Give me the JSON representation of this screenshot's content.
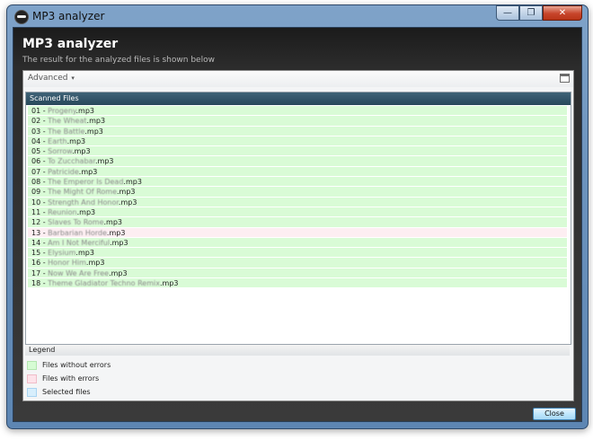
{
  "window": {
    "title": "MP3 analyzer",
    "minimize_glyph": "—",
    "maximize_glyph": "❐",
    "close_glyph": "✕"
  },
  "header": {
    "title": "MP3 analyzer",
    "subtitle": "The result for the analyzed files is shown below"
  },
  "toolbar": {
    "advanced_label": "Advanced",
    "advanced_arrow": "▾"
  },
  "files": {
    "header": "Scanned Files",
    "rows": [
      {
        "num": "01 - ",
        "name": "Progeny",
        "ext": ".mp3",
        "status": "ok"
      },
      {
        "num": "02 - ",
        "name": "The Wheat",
        "ext": ".mp3",
        "status": "ok"
      },
      {
        "num": "03 - ",
        "name": "The Battle",
        "ext": ".mp3",
        "status": "ok"
      },
      {
        "num": "04 - ",
        "name": "Earth",
        "ext": ".mp3",
        "status": "ok"
      },
      {
        "num": "05 - ",
        "name": "Sorrow",
        "ext": ".mp3",
        "status": "ok"
      },
      {
        "num": "06 - ",
        "name": "To Zucchabar",
        "ext": ".mp3",
        "status": "ok"
      },
      {
        "num": "07 - ",
        "name": "Patricide",
        "ext": ".mp3",
        "status": "ok"
      },
      {
        "num": "08 - ",
        "name": "The Emperor Is Dead",
        "ext": ".mp3",
        "status": "ok"
      },
      {
        "num": "09 - ",
        "name": "The Might Of Rome",
        "ext": ".mp3",
        "status": "ok"
      },
      {
        "num": "10 - ",
        "name": "Strength And Honor",
        "ext": ".mp3",
        "status": "ok"
      },
      {
        "num": "11 - ",
        "name": "Reunion",
        "ext": ".mp3",
        "status": "ok"
      },
      {
        "num": "12 - ",
        "name": "Slaves To Rome",
        "ext": ".mp3",
        "status": "ok"
      },
      {
        "num": "13 - ",
        "name": "Barbarian Horde",
        "ext": ".mp3",
        "status": "error"
      },
      {
        "num": "14 - ",
        "name": "Am I Not Merciful",
        "ext": ".mp3",
        "status": "ok"
      },
      {
        "num": "15 - ",
        "name": "Elysium",
        "ext": ".mp3",
        "status": "ok"
      },
      {
        "num": "16 - ",
        "name": "Honor Him",
        "ext": ".mp3",
        "status": "ok"
      },
      {
        "num": "17 - ",
        "name": "Now We Are Free",
        "ext": ".mp3",
        "status": "ok"
      },
      {
        "num": "18 - ",
        "name": "Theme Gladiator Techno Remix",
        "ext": ".mp3",
        "status": "ok"
      }
    ]
  },
  "legend": {
    "header": "Legend",
    "items": [
      {
        "label": "Files without errors",
        "color": "#d6fcd4",
        "border": "#b3e6b0"
      },
      {
        "label": "Files with errors",
        "color": "#fde3ea",
        "border": "#f0bcc8"
      },
      {
        "label": "Selected files",
        "color": "#d7eefc",
        "border": "#a9d4f2"
      }
    ]
  },
  "colors": {
    "row_ok": "#d9fbd6",
    "row_error": "#fdeef2"
  },
  "close_button": "Close"
}
